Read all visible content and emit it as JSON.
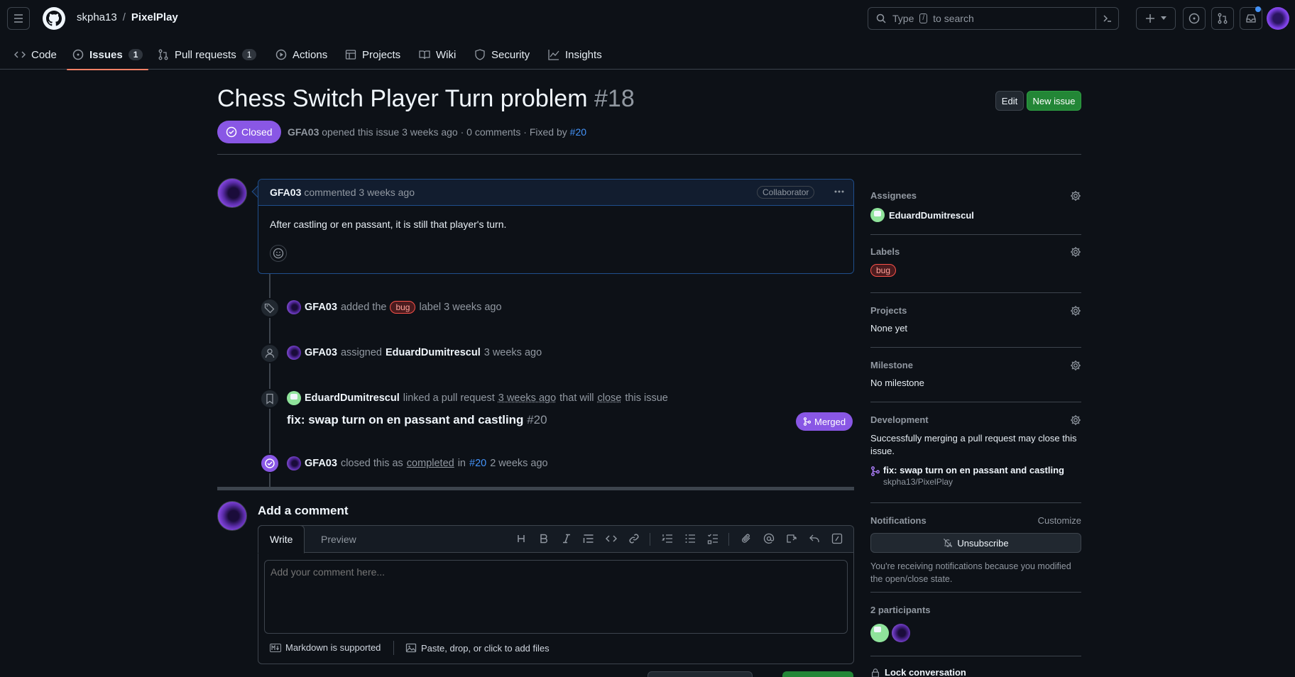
{
  "header": {
    "owner": "skpha13",
    "separator": "/",
    "repo": "PixelPlay",
    "search_prefix": "Type",
    "search_key": "/",
    "search_suffix": "to search"
  },
  "tabs": [
    {
      "label": "Code"
    },
    {
      "label": "Issues",
      "count": "1"
    },
    {
      "label": "Pull requests",
      "count": "1"
    },
    {
      "label": "Actions"
    },
    {
      "label": "Projects"
    },
    {
      "label": "Wiki"
    },
    {
      "label": "Security"
    },
    {
      "label": "Insights"
    }
  ],
  "issue": {
    "title": "Chess Switch Player Turn problem",
    "number": "#18",
    "state": "Closed",
    "edit_label": "Edit",
    "new_issue_label": "New issue",
    "author": "GFA03",
    "opened_text": "opened this issue 3 weeks ago · 0 comments · Fixed by",
    "fixed_by": "#20"
  },
  "comment": {
    "author": "GFA03",
    "time": "commented 3 weeks ago",
    "badge": "Collaborator",
    "body": "After castling or en passant, it is still that player's turn."
  },
  "timeline": {
    "e1": {
      "actor": "GFA03",
      "pre": "added the",
      "label": "bug",
      "post": "label 3 weeks ago"
    },
    "e2": {
      "actor": "GFA03",
      "action": "assigned",
      "target": "EduardDumitrescul",
      "time": "3 weeks ago"
    },
    "e3": {
      "actor": "EduardDumitrescul",
      "pre": "linked a pull request",
      "time": "3 weeks ago",
      "mid": "that will",
      "close": "close",
      "post": "this issue",
      "pr_title": "fix: swap turn on en passant and castling",
      "pr_num": "#20",
      "pr_state": "Merged"
    },
    "e4": {
      "actor": "GFA03",
      "pre": "closed this as",
      "completed": "completed",
      "in": "in",
      "pr": "#20",
      "time": "2 weeks ago"
    }
  },
  "composer": {
    "title": "Add a comment",
    "write_tab": "Write",
    "preview_tab": "Preview",
    "placeholder": "Add your comment here...",
    "markdown_note": "Markdown is supported",
    "files_note": "Paste, drop, or click to add files"
  },
  "sidebar": {
    "assignees": {
      "heading": "Assignees",
      "value": "EduardDumitrescul"
    },
    "labels": {
      "heading": "Labels",
      "value": "bug"
    },
    "projects": {
      "heading": "Projects",
      "value": "None yet"
    },
    "milestone": {
      "heading": "Milestone",
      "value": "No milestone"
    },
    "development": {
      "heading": "Development",
      "note": "Successfully merging a pull request may close this issue.",
      "pr_title": "fix: swap turn on en passant and castling",
      "pr_repo": "skpha13/PixelPlay"
    },
    "notifications": {
      "heading": "Notifications",
      "customize": "Customize",
      "button": "Unsubscribe",
      "reason": "You're receiving notifications because you modified the open/close state."
    },
    "participants": {
      "heading": "2 participants"
    },
    "lock": "Lock conversation"
  },
  "colors": {
    "accent_purple": "#8957e5",
    "green": "#238636",
    "link": "#4493f8",
    "bug_red": "#f85149"
  }
}
